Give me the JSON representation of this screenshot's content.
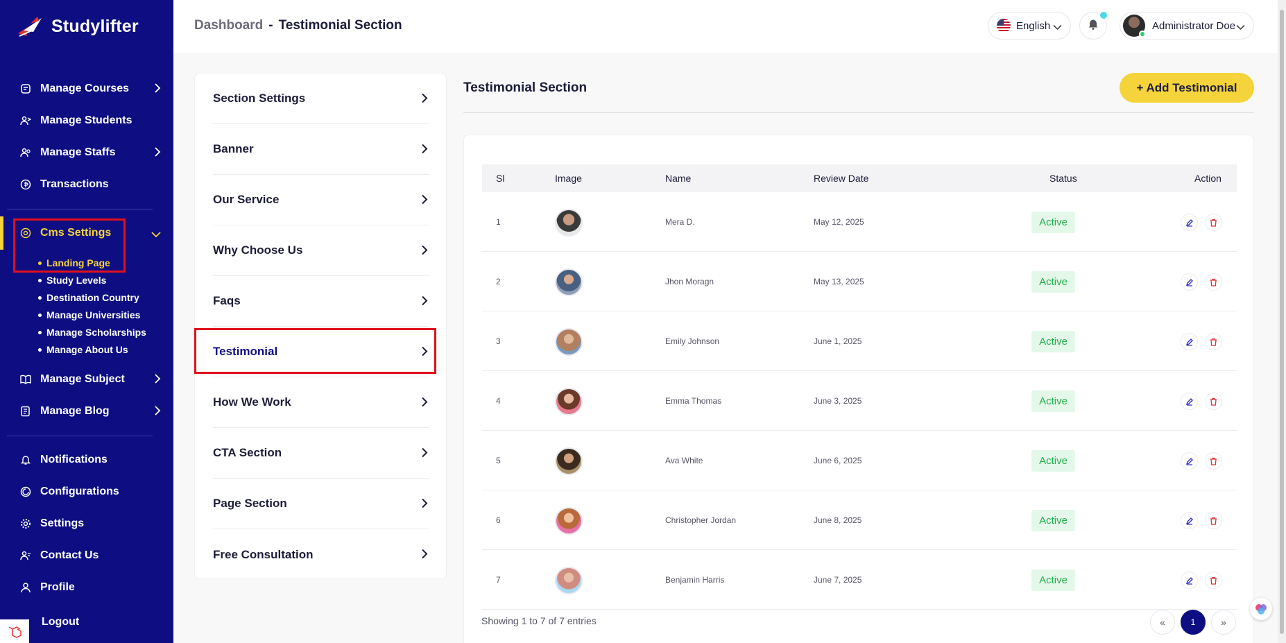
{
  "app": {
    "name": "Studylifter"
  },
  "colors": {
    "sidebar": "#0e0e82",
    "accent": "#f5d33a",
    "highlight": "#e0101a",
    "active_green": "#22b04a"
  },
  "header": {
    "breadcrumb_root": "Dashboard",
    "breadcrumb_sep": "-",
    "breadcrumb_current": "Testimonial Section",
    "language": "English",
    "user_name": "Administrator Doe"
  },
  "sidebar": {
    "items": [
      {
        "label": "Manage Courses",
        "icon": "courses-icon"
      },
      {
        "label": "Manage Students",
        "icon": "students-icon"
      },
      {
        "label": "Manage Staffs",
        "icon": "staffs-icon"
      },
      {
        "label": "Transactions",
        "icon": "transactions-icon"
      },
      {
        "label": "Cms Settings",
        "icon": "cms-icon"
      },
      {
        "label": "Manage Subject",
        "icon": "book-icon"
      },
      {
        "label": "Manage Blog",
        "icon": "blog-icon"
      },
      {
        "label": "Notifications",
        "icon": "bell-icon"
      },
      {
        "label": "Configurations",
        "icon": "config-icon"
      },
      {
        "label": "Settings",
        "icon": "gear-icon"
      },
      {
        "label": "Contact Us",
        "icon": "contact-icon"
      },
      {
        "label": "Profile",
        "icon": "user-icon"
      },
      {
        "label": "Logout",
        "icon": "logout-icon"
      }
    ],
    "cms_subitems": [
      "Landing Page",
      "Study Levels",
      "Destination Country",
      "Manage Universities",
      "Manage Scholarships",
      "Manage About Us"
    ]
  },
  "section_menu": [
    "Section Settings",
    "Banner",
    "Our Service",
    "Why Choose Us",
    "Faqs",
    "Testimonial",
    "How We Work",
    "CTA Section",
    "Page Section",
    "Free Consultation"
  ],
  "content": {
    "title": "Testimonial Section",
    "add_button": "+ Add Testimonial"
  },
  "table": {
    "headers": [
      "Sl",
      "Image",
      "Name",
      "Review Date",
      "Status",
      "Action"
    ],
    "rows": [
      {
        "sl": "1",
        "name": "Mera D.",
        "date": "May 12, 2025",
        "status": "Active"
      },
      {
        "sl": "2",
        "name": "Jhon Moragn",
        "date": "May 13, 2025",
        "status": "Active"
      },
      {
        "sl": "3",
        "name": "Emily Johnson",
        "date": "June 1, 2025",
        "status": "Active"
      },
      {
        "sl": "4",
        "name": "Emma Thomas",
        "date": "June 3, 2025",
        "status": "Active"
      },
      {
        "sl": "5",
        "name": "Ava White",
        "date": "June 6, 2025",
        "status": "Active"
      },
      {
        "sl": "6",
        "name": "Christopher Jordan",
        "date": "June 8, 2025",
        "status": "Active"
      },
      {
        "sl": "7",
        "name": "Benjamin Harris",
        "date": "June 7, 2025",
        "status": "Active"
      }
    ],
    "showing": "Showing 1 to 7 of 7 entries",
    "pagination": {
      "prev": "«",
      "current": "1",
      "next": "»"
    }
  }
}
